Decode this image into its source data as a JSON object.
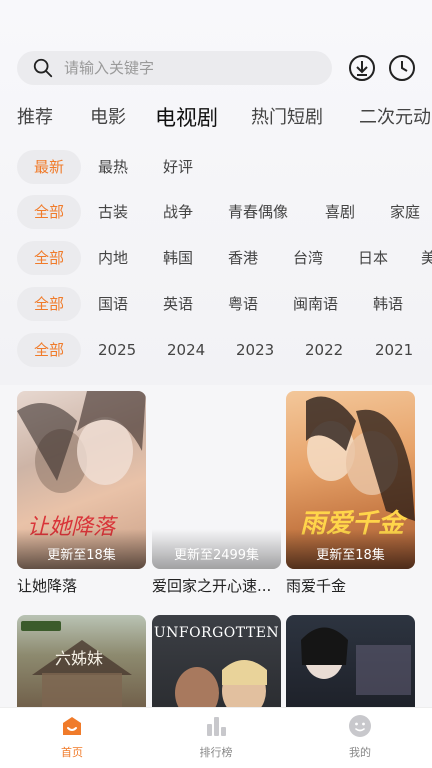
{
  "search": {
    "placeholder": "请输入关键字"
  },
  "header_icons": [
    "download-icon",
    "history-icon"
  ],
  "tabs": [
    {
      "label": "推荐",
      "active": false
    },
    {
      "label": "电影",
      "active": false
    },
    {
      "label": "电视剧",
      "active": true
    },
    {
      "label": "热门短剧",
      "active": false
    },
    {
      "label": "二次元动",
      "active": false
    }
  ],
  "filters": {
    "sort": [
      "最新",
      "最热",
      "好评"
    ],
    "genre": [
      "全部",
      "古装",
      "战争",
      "青春偶像",
      "喜剧",
      "家庭"
    ],
    "region": [
      "全部",
      "内地",
      "韩国",
      "香港",
      "台湾",
      "日本",
      "美"
    ],
    "language": [
      "全部",
      "国语",
      "英语",
      "粤语",
      "闽南语",
      "韩语"
    ],
    "year": [
      "全部",
      "2025",
      "2024",
      "2023",
      "2022",
      "2021"
    ]
  },
  "cards": [
    {
      "title": "让她降落",
      "status": "更新至18集",
      "poster_text": "让她降落"
    },
    {
      "title": "爱回家之开心速...",
      "status": "更新至2499集",
      "poster_text": ""
    },
    {
      "title": "雨爱千金",
      "status": "更新至18集",
      "poster_text": "雨爱千金"
    }
  ],
  "cards_row2": [
    {
      "poster_text": "六姊妹"
    },
    {
      "poster_text": "UNFORGOTTEN"
    },
    {
      "poster_text": ""
    }
  ],
  "bottom_nav": [
    {
      "label": "首页",
      "active": true
    },
    {
      "label": "排行榜",
      "active": false
    },
    {
      "label": "我的",
      "active": false
    }
  ],
  "colors": {
    "accent": "#f07b2a",
    "chip_bg": "#ebebee",
    "background": "#f6f6f8"
  }
}
